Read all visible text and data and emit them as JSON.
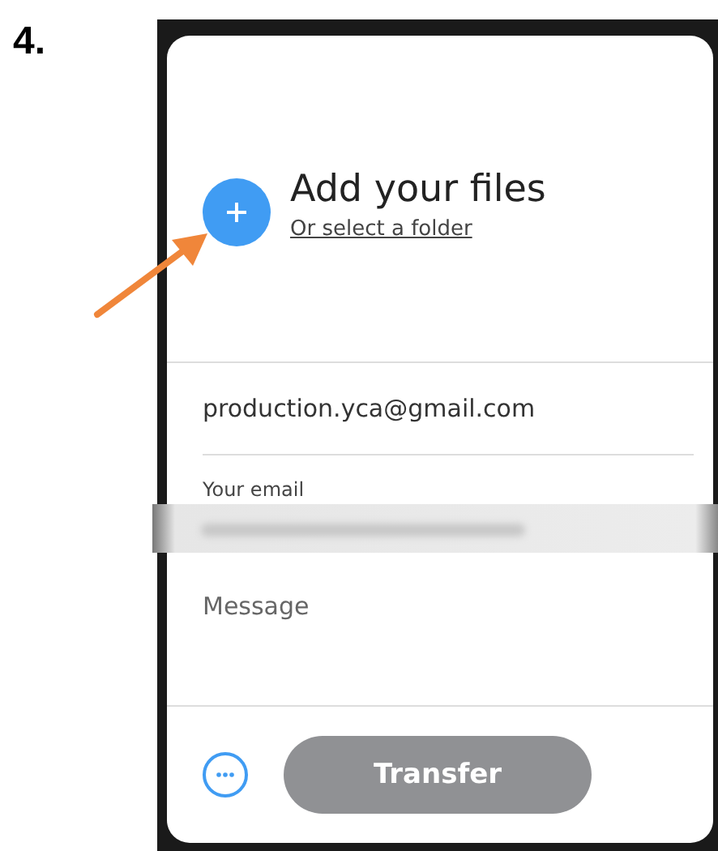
{
  "step_label": "4.",
  "upload": {
    "title": "Add your files",
    "link": "Or select a folder"
  },
  "recipient": {
    "value": "production.yca@gmail.com"
  },
  "sender": {
    "label": "Your email"
  },
  "message": {
    "placeholder": "Message"
  },
  "transfer_button": {
    "label": "Transfer",
    "disabled": true
  }
}
